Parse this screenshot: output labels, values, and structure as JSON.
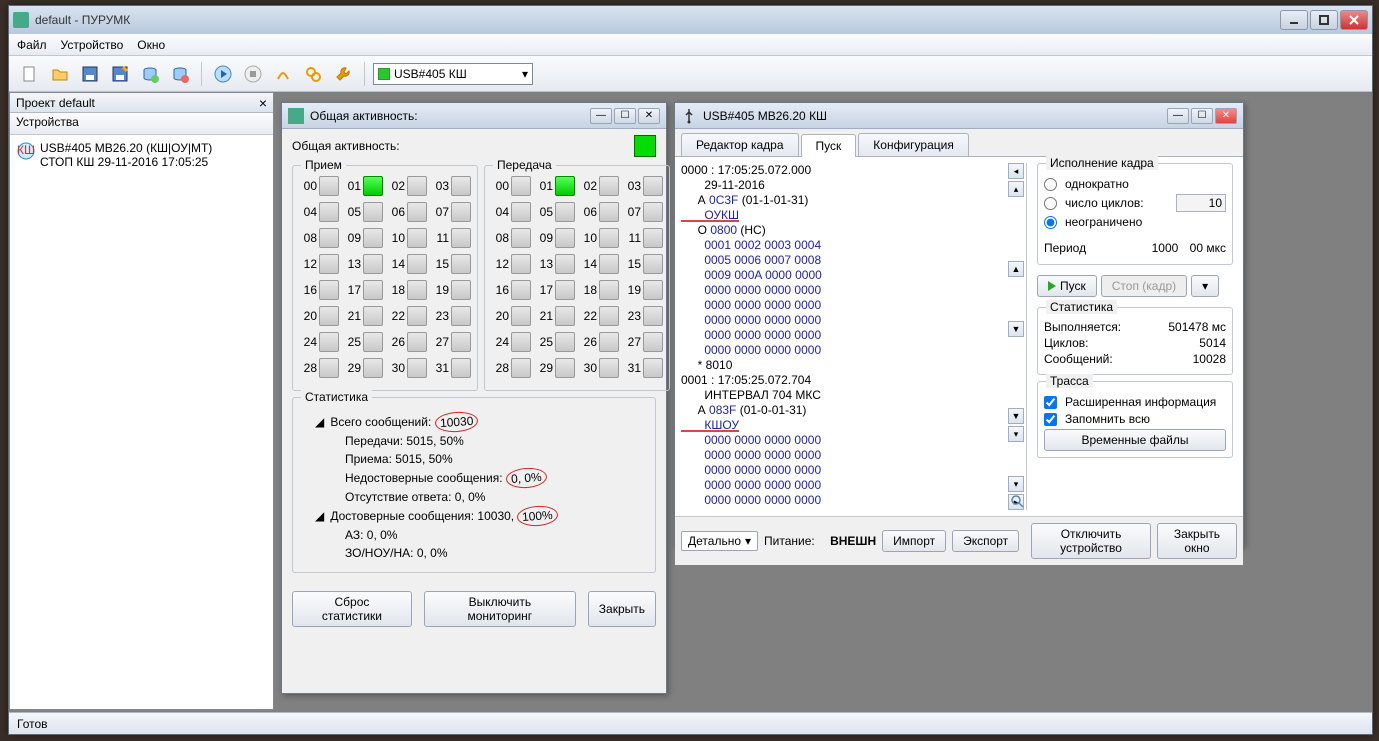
{
  "window": {
    "title": "default - ПУРУМК"
  },
  "menu": {
    "file": "Файл",
    "device": "Устройство",
    "window": "Окно"
  },
  "toolbar": {
    "device": "USB#405 КШ"
  },
  "project": {
    "header": "Проект default",
    "sub": "Устройства",
    "device_line1": "USB#405  МВ26.20 (КШ|ОУ|МТ)",
    "device_line2": "СТОП  КШ 29-11-2016 17:05:25"
  },
  "activity": {
    "title": "Общая активность:",
    "header": "Общая активность:",
    "recv": "Прием",
    "send": "Передача",
    "nums": [
      "00",
      "01",
      "02",
      "03",
      "04",
      "05",
      "06",
      "07",
      "08",
      "09",
      "10",
      "11",
      "12",
      "13",
      "14",
      "15",
      "16",
      "17",
      "18",
      "19",
      "20",
      "21",
      "22",
      "23",
      "24",
      "25",
      "26",
      "27",
      "28",
      "29",
      "30",
      "31"
    ],
    "stats_title": "Статистика",
    "total_label": "Всего сообщений:",
    "total_val": "10030",
    "tx": "Передачи: 5015, 50%",
    "rx": "Приема: 5015, 50%",
    "bad_label": "Недостоверные сообщения:",
    "bad_val": "0, 0%",
    "noresp": "Отсутствие ответа: 0, 0%",
    "good_label": "Достоверные сообщения: 10030,",
    "good_val": "100%",
    "az": "АЗ: 0, 0%",
    "zo": "ЗО/НОУ/НА: 0, 0%",
    "btn_reset": "Сброс статистики",
    "btn_mon": "Выключить мониторинг",
    "btn_close": "Закрыть"
  },
  "cfg": {
    "title": "USB#405 МВ26.20 КШ",
    "tab_editor": "Редактор кадра",
    "tab_run": "Пуск",
    "tab_cfg": "Конфигурация",
    "log": [
      {
        "t": "idx",
        "s": "0000 : 17:05:25.072.000"
      },
      {
        "t": "plain",
        "s": "       29-11-2016"
      },
      {
        "t": "a",
        "s": "     А ",
        "h": "0C3F",
        "r": " (01-1-01-31)"
      },
      {
        "t": "u",
        "s": "       ОУКШ"
      },
      {
        "t": "o",
        "s": "     О ",
        "h": "0800",
        "r": " (НС)"
      },
      {
        "t": "hex",
        "s": "       0001 0002 0003 0004"
      },
      {
        "t": "hex",
        "s": "       0005 0006 0007 0008"
      },
      {
        "t": "hex",
        "s": "       0009 000A 0000 0000"
      },
      {
        "t": "hex",
        "s": "       0000 0000 0000 0000"
      },
      {
        "t": "hex",
        "s": "       0000 0000 0000 0000"
      },
      {
        "t": "hex",
        "s": "       0000 0000 0000 0000"
      },
      {
        "t": "hex",
        "s": "       0000 0000 0000 0000"
      },
      {
        "t": "hex",
        "s": "       0000 0000 0000 0000"
      },
      {
        "t": "plain",
        "s": "     * 8010"
      },
      {
        "t": "idx",
        "s": "0001 : 17:05:25.072.704"
      },
      {
        "t": "plain",
        "s": "       ИНТЕРВАЛ 704 МКС"
      },
      {
        "t": "a",
        "s": "     А ",
        "h": "083F",
        "r": " (01-0-01-31)"
      },
      {
        "t": "u",
        "s": "       КШОУ"
      },
      {
        "t": "hex",
        "s": "       0000 0000 0000 0000"
      },
      {
        "t": "hex",
        "s": "       0000 0000 0000 0000"
      },
      {
        "t": "hex",
        "s": "       0000 0000 0000 0000"
      },
      {
        "t": "hex",
        "s": "       0000 0000 0000 0000"
      },
      {
        "t": "hex",
        "s": "       0000 0000 0000 0000"
      }
    ],
    "exec_title": "Исполнение кадра",
    "once": "однократно",
    "cycles": "число циклов:",
    "cycles_val": "10",
    "unlim": "неограничено",
    "period": "Период",
    "period_val": "1000",
    "period_unit": "00 мкс",
    "btn_run": "Пуск",
    "btn_stop": "Стоп (кадр)",
    "stats_title": "Статистика",
    "exec_k": "Выполняется:",
    "exec_v": "501478 мс",
    "cyc_k": "Циклов:",
    "cyc_v": "5014",
    "msg_k": "Сообщений:",
    "msg_v": "10028",
    "trace_title": "Трасса",
    "extinfo": "Расширенная информация",
    "remember": "Запомнить всю",
    "tmpfiles": "Временные файлы",
    "detail": "Детально",
    "power_label": "Питание:",
    "power_val": "ВНЕШН",
    "btn_import": "Импорт",
    "btn_export": "Экспорт",
    "btn_disconnect": "Отключить устройство",
    "btn_closewin": "Закрыть окно"
  },
  "status": "Готов"
}
